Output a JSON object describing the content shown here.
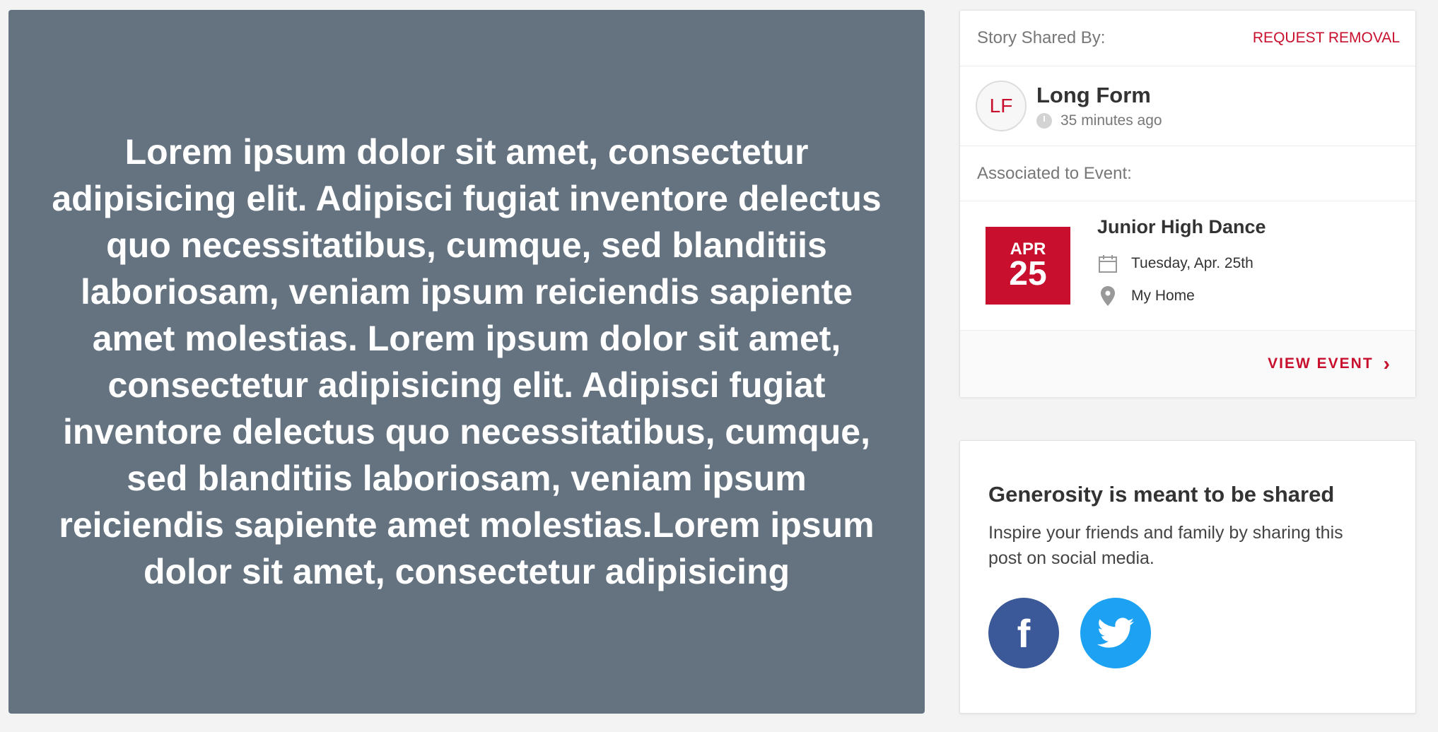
{
  "story": {
    "text": "Lorem ipsum dolor sit amet, consectetur adipisicing elit. Adipisci fugiat inventore delectus quo necessitatibus, cumque, sed blanditiis laboriosam, veniam ipsum reiciendis sapiente amet molestias. Lorem ipsum dolor sit amet, consectetur adipisicing elit. Adipisci fugiat inventore delectus quo necessitatibus, cumque, sed blanditiis laboriosam, veniam ipsum reiciendis sapiente amet molestias.Lorem ipsum dolor sit amet, consectetur adipisicing",
    "background_color": "#5d6b7a"
  },
  "share_info": {
    "shared_by_label": "Story Shared By:",
    "request_removal_label": "REQUEST REMOVAL",
    "author": {
      "initials": "LF",
      "name": "Long Form",
      "time": "35 minutes ago"
    },
    "associated_label": "Associated to Event:",
    "event": {
      "month": "APR",
      "day": "25",
      "title": "Junior High Dance",
      "date": "Tuesday, Apr. 25th",
      "location": "My Home"
    },
    "view_event_label": "VIEW EVENT",
    "accent_color": "#c8102e"
  },
  "social": {
    "heading": "Generosity is meant to be shared",
    "body": "Inspire your friends and family by sharing this post on social media.",
    "buttons": [
      {
        "name": "facebook",
        "glyph": "f",
        "color": "#3b5998"
      },
      {
        "name": "twitter",
        "color": "#1da1f2"
      }
    ]
  }
}
